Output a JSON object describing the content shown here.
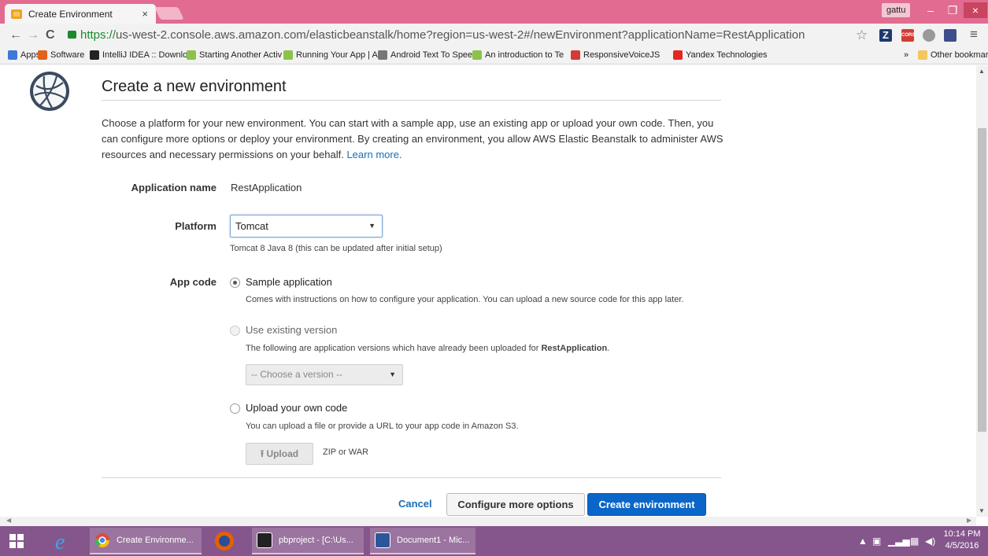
{
  "browser": {
    "tab_title": "Create Environment",
    "tab_close": "×",
    "profile_name": "gattu",
    "window_min": "–",
    "window_max": "❐",
    "window_close": "×",
    "url_scheme": "https://",
    "url_rest": "us-west-2.console.aws.amazon.com/elasticbeanstalk/home?region=us-west-2#/newEnvironment?applicationName=RestApplication",
    "back_glyph": "←",
    "forward_glyph": "→",
    "reload_glyph": "C",
    "star_glyph": "☆",
    "menu_glyph": "≡",
    "ext_z": "Z",
    "ext_cors": "CORS"
  },
  "bookmarks": {
    "items": [
      {
        "label": "Apps",
        "color": "#3c78d8"
      },
      {
        "label": "Software",
        "color": "#e3621b"
      },
      {
        "label": "IntelliJ IDEA :: Downlo",
        "color": "#222222"
      },
      {
        "label": "Starting Another Activ",
        "color": "#8bc34a"
      },
      {
        "label": "Running Your App | A",
        "color": "#8bc34a"
      },
      {
        "label": "Android Text To Spee",
        "color": "#777777"
      },
      {
        "label": "An introduction to Te",
        "color": "#8bc34a"
      },
      {
        "label": "ResponsiveVoiceJS",
        "color": "#d43b34"
      },
      {
        "label": "Yandex Technologies",
        "color": "#e52620"
      }
    ],
    "overflow": "»",
    "other": "Other bookmarks"
  },
  "page": {
    "title": "Create a new environment",
    "intro_text": "Choose a platform for your new environment. You can start with a sample app, use an existing app or upload your own code. Then, you can configure more options or deploy your environment. By creating an environment, you allow AWS Elastic Beanstalk to administer AWS resources and necessary permissions on your behalf.",
    "learn_more": "Learn more.",
    "app_name_label": "Application name",
    "app_name_value": "RestApplication",
    "platform_label": "Platform",
    "platform_value": "Tomcat",
    "platform_help": "Tomcat 8 Java 8 (this can be updated after initial setup)",
    "app_code_label": "App code",
    "sample_label": "Sample application",
    "sample_help": "Comes with instructions on how to configure your application. You can upload a new source code for this app later.",
    "existing_label": "Use existing version",
    "existing_help_prefix": "The following are application versions which have already been uploaded for ",
    "existing_help_app": "RestApplication",
    "existing_help_suffix": ".",
    "version_placeholder": "-- Choose a version --",
    "upload_label": "Upload your own code",
    "upload_help": "You can upload a file or provide a URL to your app code in Amazon S3.",
    "upload_button": "Upload",
    "upload_hint": "ZIP or WAR",
    "cancel": "Cancel",
    "configure": "Configure more options",
    "create": "Create environment"
  },
  "taskbar": {
    "items": [
      "Create Environme...",
      "pbproject - [C:\\Us...",
      "Document1 - Mic..."
    ],
    "time": "10:14 PM",
    "date": "4/5/2016"
  },
  "colors": {
    "titlebar": "#e26b91",
    "primary_button": "#0a66c9",
    "link": "#1a6db5",
    "taskbar": "#85568c"
  }
}
